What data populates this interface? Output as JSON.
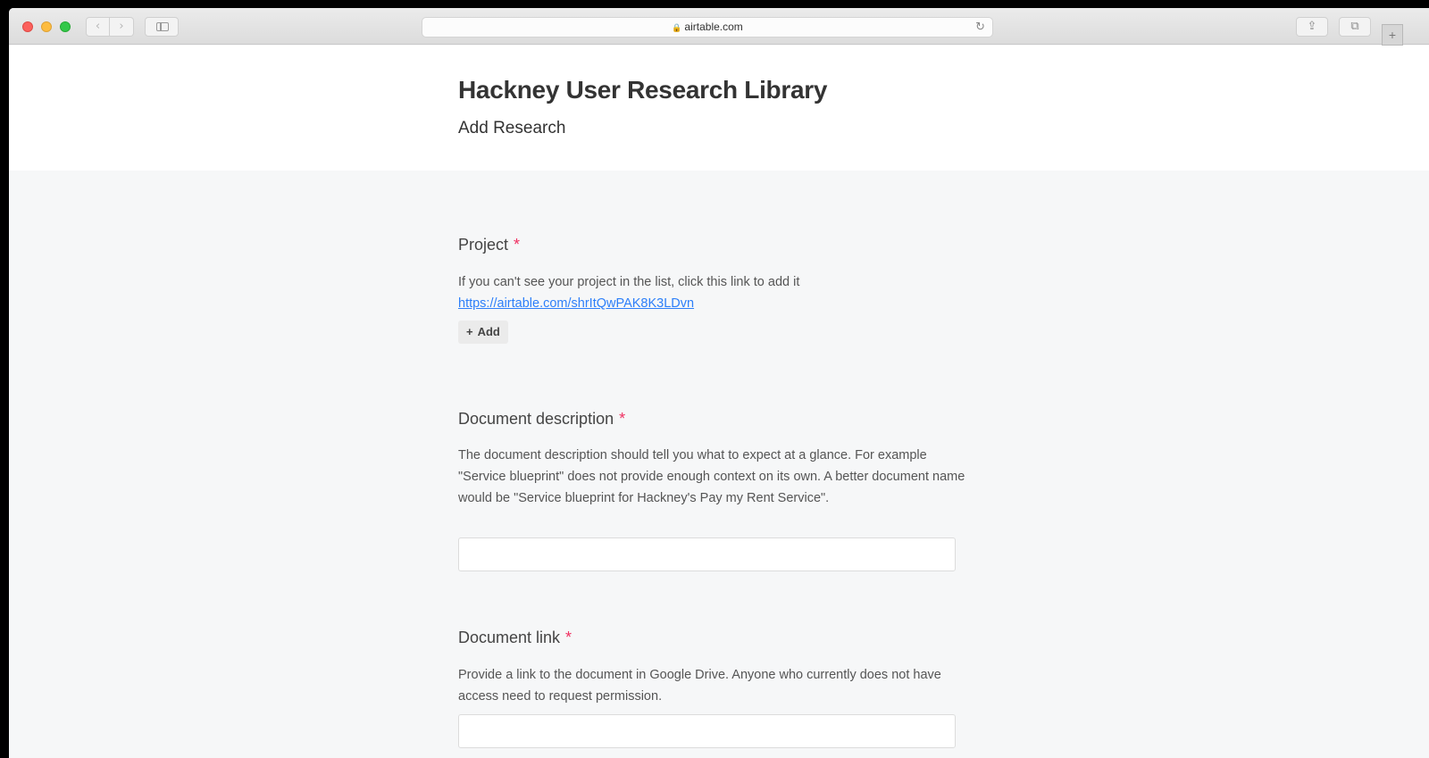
{
  "browser": {
    "url": "airtable.com",
    "lock_icon": "lock-icon",
    "back_glyph": "‹",
    "forward_glyph": "›",
    "reload_glyph": "↻",
    "share_glyph": "⇪",
    "tabs_glyph": "⧉",
    "new_tab_glyph": "+"
  },
  "form": {
    "title": "Hackney User Research Library",
    "subtitle": "Add Research",
    "required_mark": "*",
    "fields": [
      {
        "label": "Project",
        "help": "If you can't see your project in the list, click this link to add it",
        "link": "https://airtable.com/shrItQwPAK8K3LDvn",
        "add_label": "Add",
        "add_icon": "+"
      },
      {
        "label": "Document description",
        "help": "The document description should tell you what to expect at a glance. For example \"Service blueprint\" does not provide enough context on its own. A better document name would be \"Service blueprint for Hackney's Pay my Rent Service\".",
        "value": ""
      },
      {
        "label": "Document link",
        "help": "Provide a link to the document in Google Drive. Anyone who currently does not have access need to request permission.",
        "value": ""
      }
    ]
  },
  "colors": {
    "required": "#ef3061",
    "link": "#2d7ff9",
    "page_background": "#f6f7f8",
    "header_background": "#ffffff"
  }
}
